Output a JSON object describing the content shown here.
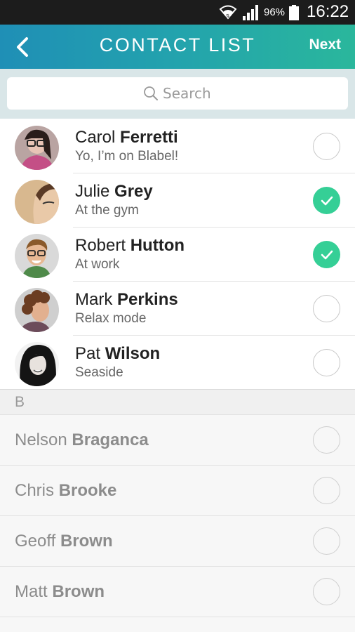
{
  "status_bar": {
    "battery_pct": "96%",
    "time": "16:22",
    "icons": [
      "wifi-icon",
      "signal-icon",
      "battery-icon"
    ]
  },
  "header": {
    "title": "CONTACT LIST",
    "next_label": "Next",
    "back_icon": "chevron-left-icon"
  },
  "search": {
    "placeholder": "Search",
    "icon": "search-icon"
  },
  "colors": {
    "header_gradient_start": "#1f8fb6",
    "header_gradient_end": "#2ab79c",
    "check_selected": "#35cf96"
  },
  "contacts": [
    {
      "first": "Carol",
      "last": "Ferretti",
      "status": "Yo, I’m on Blabel!",
      "selected": false
    },
    {
      "first": "Julie",
      "last": "Grey",
      "status": "At the gym",
      "selected": true
    },
    {
      "first": "Robert",
      "last": "Hutton",
      "status": "At work",
      "selected": true
    },
    {
      "first": "Mark",
      "last": "Perkins",
      "status": "Relax mode",
      "selected": false
    },
    {
      "first": "Pat",
      "last": "Wilson",
      "status": "Seaside",
      "selected": false
    }
  ],
  "section_b": {
    "letter": "B",
    "contacts": [
      {
        "first": "Nelson",
        "last": "Braganca",
        "selected": false
      },
      {
        "first": "Chris",
        "last": "Brooke",
        "selected": false
      },
      {
        "first": "Geoff",
        "last": "Brown",
        "selected": false
      },
      {
        "first": "Matt",
        "last": "Brown",
        "selected": false
      }
    ]
  }
}
